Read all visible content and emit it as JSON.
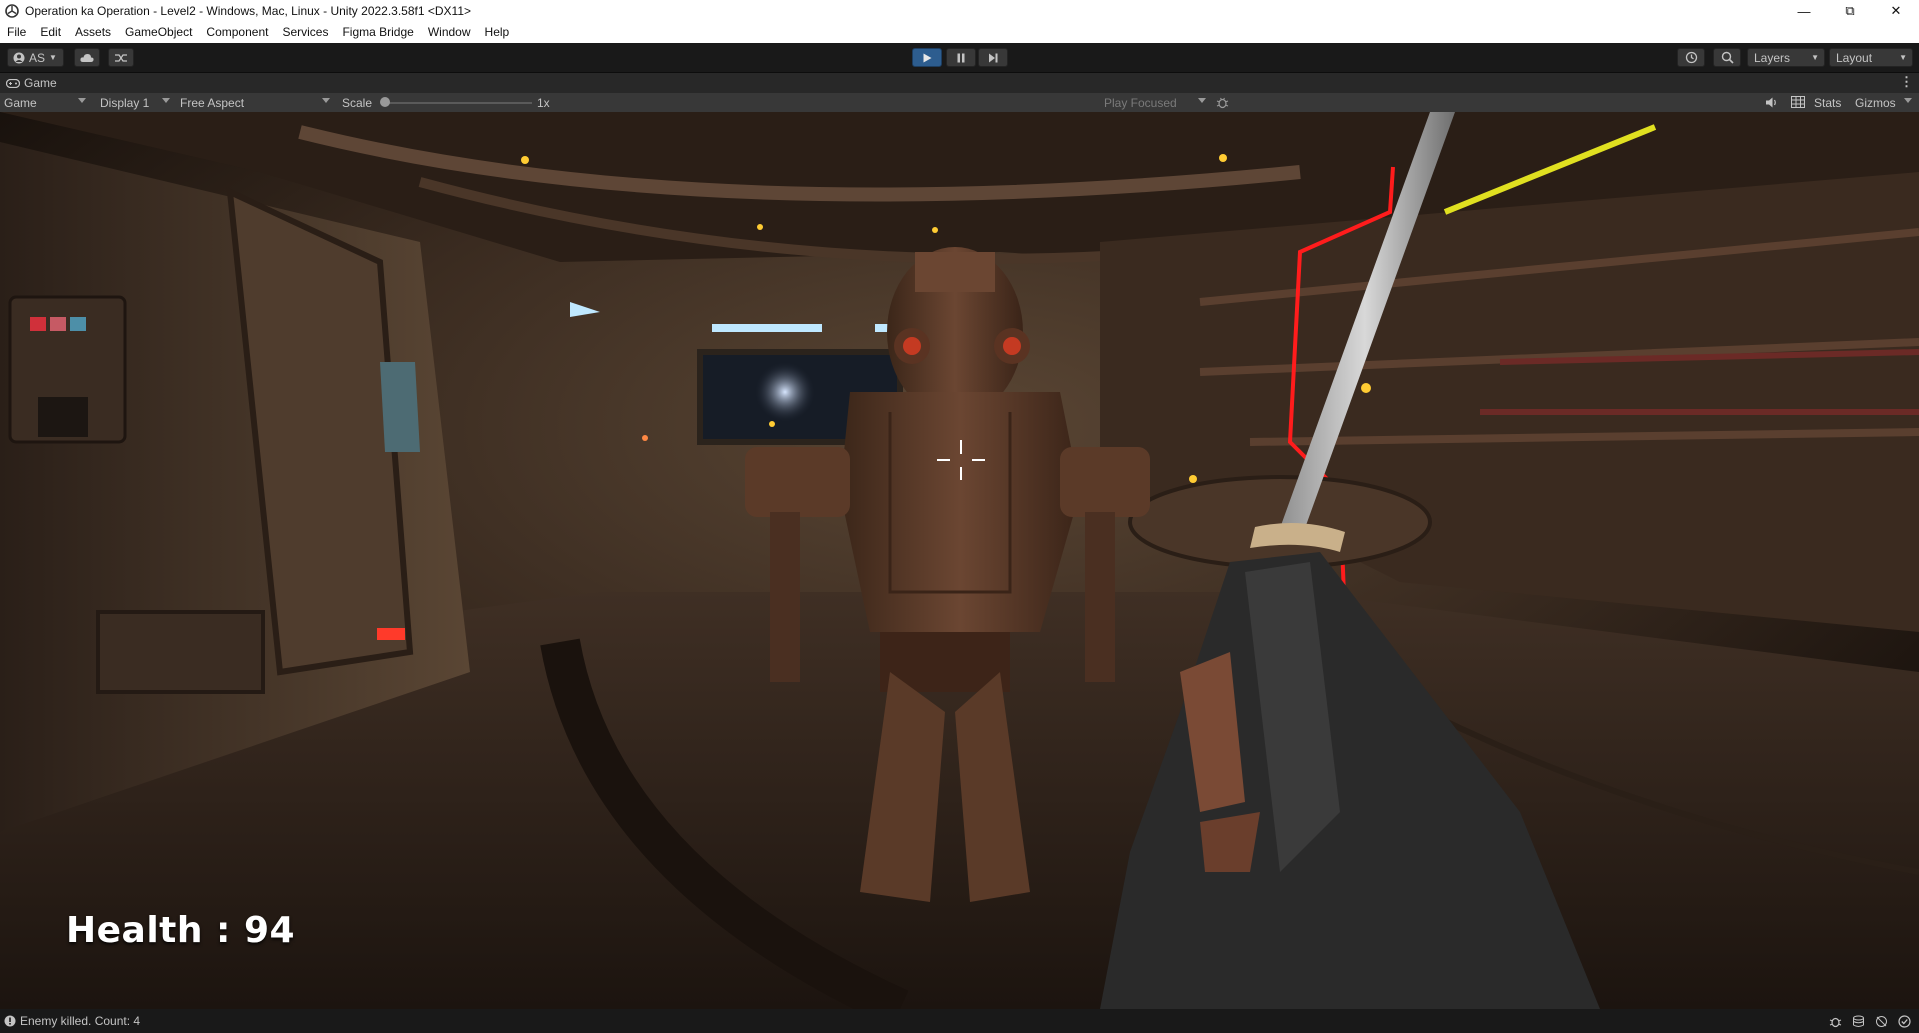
{
  "window": {
    "title": "Operation ka Operation - Level2 - Windows, Mac, Linux - Unity 2022.3.58f1 <DX11>"
  },
  "menu": [
    "File",
    "Edit",
    "Assets",
    "GameObject",
    "Component",
    "Services",
    "Figma Bridge",
    "Window",
    "Help"
  ],
  "toolbar": {
    "account_label": "AS",
    "layers_label": "Layers",
    "layout_label": "Layout"
  },
  "tab": {
    "label": "Game"
  },
  "gamebar": {
    "view_mode": "Game",
    "display": "Display 1",
    "aspect": "Free Aspect",
    "scale_label": "Scale",
    "scale_value": "1x",
    "play_mode": "Play Focused",
    "stats_label": "Stats",
    "gizmos_label": "Gizmos"
  },
  "hud": {
    "health_text": "Health : 94"
  },
  "status": {
    "message": "Enemy killed. Count: 4"
  },
  "colors": {
    "play_active": "#2d5d8f",
    "editor_bg": "#191919",
    "panel": "#383838"
  }
}
